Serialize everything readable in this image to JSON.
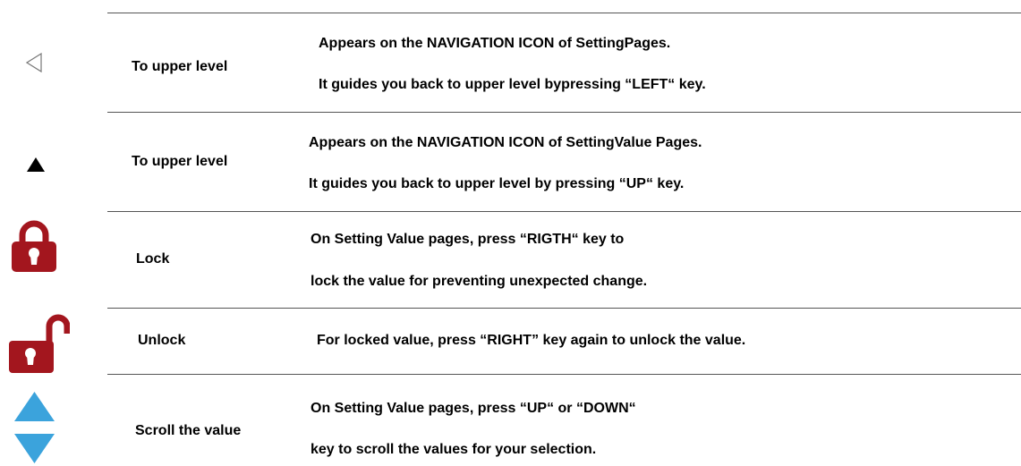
{
  "rows": [
    {
      "icon": "left-arrow-outline-icon",
      "label": "To upper level",
      "lines": [
        "Appears on the NAVIGATION ICON of SettingPages.",
        "It guides you back to upper level bypressing “LEFT“ key."
      ]
    },
    {
      "icon": "up-triangle-icon",
      "label": "To upper level",
      "lines": [
        "Appears on the NAVIGATION ICON of SettingValue Pages.",
        "It guides you back to upper level by pressing “UP“ key."
      ]
    },
    {
      "icon": "lock-icon",
      "label": "Lock",
      "lines": [
        "On Setting Value pages, press “RIGTH“ key to",
        "lock the value for preventing unexpected change."
      ]
    },
    {
      "icon": "unlock-icon",
      "label": "Unlock",
      "lines": [
        "For locked value, press “RIGHT” key again to unlock the value."
      ]
    },
    {
      "icon": "scroll-up-down-icon",
      "label": "Scroll the value",
      "lines": [
        "On Setting Value pages, press “UP“ or “DOWN“",
        "key to scroll the values for your selection."
      ]
    }
  ],
  "colors": {
    "lock": "#A3161E",
    "scroll_arrows": "#3BA3DC",
    "triangle": "#000000",
    "rules": "#555555"
  }
}
